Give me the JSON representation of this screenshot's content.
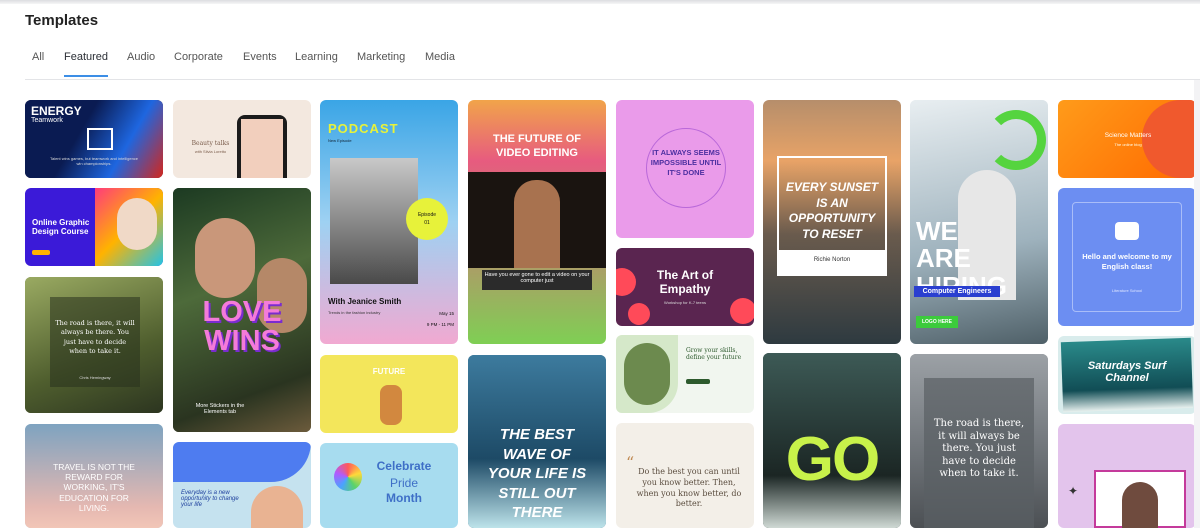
{
  "header": {
    "title": "Templates"
  },
  "tabs": [
    "All",
    "Featured",
    "Audio",
    "Corporate",
    "Events",
    "Learning",
    "Marketing",
    "Media"
  ],
  "cards": {
    "energy": {
      "title": "ENERGY",
      "sub": "Teamwork",
      "quote": "Talent wins games, but teamwork and intelligence win championships."
    },
    "beauty": {
      "title": "Beauty talks",
      "sub": "with Silvia Loretto"
    },
    "podcast": {
      "title": "PODCAST",
      "sub": "New Episode",
      "badge_1": "Episode",
      "badge_2": "01",
      "host": "With Jeanice Smith",
      "topic": "Trends in the fashion industry",
      "date": "May 15",
      "time": "9 PM - 11 PM"
    },
    "future": {
      "title": "THE FUTURE OF VIDEO EDITING",
      "caption": "Have you ever gone to edit a video on your computer just"
    },
    "impossible": {
      "text": "IT ALWAYS SEEMS IMPOSSIBLE UNTIL IT'S DONE"
    },
    "sunset": {
      "text": "EVERY SUNSET IS AN OPPORTUNITY TO RESET",
      "author": "Richie Norton"
    },
    "hiring": {
      "title": "WE ARE HIRING",
      "tag": "Computer Engineers",
      "btn": "LOGO HERE"
    },
    "science": {
      "title": "Science Matters",
      "sub": "The online blog"
    },
    "graphic": {
      "title": "Online Graphic Design Course"
    },
    "love": {
      "title": "LOVE WINS",
      "sub": "More Stickers in the Elements tab"
    },
    "art": {
      "title": "The Art of Empathy",
      "sub": "Workshop for K-7 teens"
    },
    "english": {
      "text": "Hello and welcome to my English class!",
      "sub": "Literature School"
    },
    "road1": {
      "text": "The road is there, it will always be there. You just have to decide when to take it.",
      "author": "Chris Hemingway"
    },
    "future2": {
      "text": "FUTURE"
    },
    "grow": {
      "text": "Grow your skills, define your future"
    },
    "wave": {
      "text": "THE BEST WAVE OF YOUR LIFE IS STILL OUT THERE"
    },
    "go": {
      "text": "GO"
    },
    "road2": {
      "text": "The road is there, it will always be there. You just have to decide when to take it."
    },
    "surf": {
      "text": "Saturdays Surf Channel"
    },
    "travel": {
      "text": "TRAVEL IS NOT THE REWARD FOR WORKING, IT'S EDUCATION FOR LIVING."
    },
    "everyday": {
      "text": "Everyday is a new opportunity to change your life"
    },
    "pride": {
      "title": "Celebrate",
      "sub1": "Pride",
      "sub2": "Month"
    },
    "dothebest": {
      "text": "Do the best you can until you know better. Then, when you know better, do better."
    }
  },
  "colors": {
    "accent": "#3c8ee6",
    "text": "#222222"
  }
}
